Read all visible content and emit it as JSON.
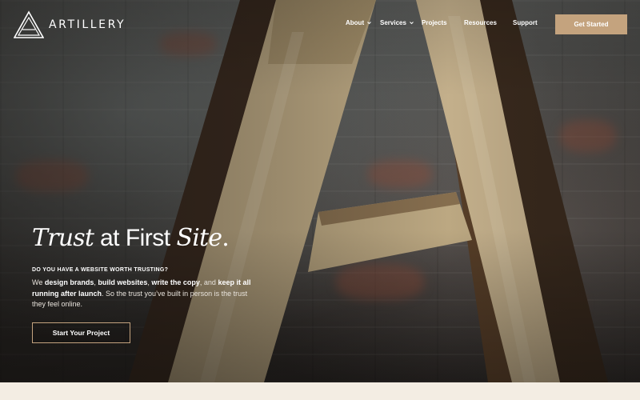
{
  "brand": {
    "name": "ARTILLERY",
    "logo_icon": "a-triangle-logo-icon"
  },
  "nav": {
    "items": [
      {
        "label": "About",
        "has_dropdown": true
      },
      {
        "label": "Services",
        "has_dropdown": true
      },
      {
        "label": "Projects",
        "has_dropdown": false
      },
      {
        "label": "Resources",
        "has_dropdown": false
      },
      {
        "label": "Support",
        "has_dropdown": false
      }
    ],
    "cta_label": "Get Started"
  },
  "hero": {
    "headline": {
      "part1": "Trust",
      "part2": " at First ",
      "part3": "Site",
      "part4": "."
    },
    "eyebrow": "DO YOU HAVE A WEBSITE WORTH TRUSTING?",
    "body": {
      "s1": "We ",
      "b1": "design brands",
      "s2": ", ",
      "b2": "build websites",
      "s3": ", ",
      "b3": "write the copy",
      "s4": ", and ",
      "b4": "keep it all running after launch",
      "s5": ". So the trust you’ve built in person is the trust they feel online."
    },
    "cta_label": "Start Your Project"
  },
  "colors": {
    "accent": "#c4a37e",
    "text_light": "#ffffff",
    "page_bg": "#f3ede3"
  }
}
